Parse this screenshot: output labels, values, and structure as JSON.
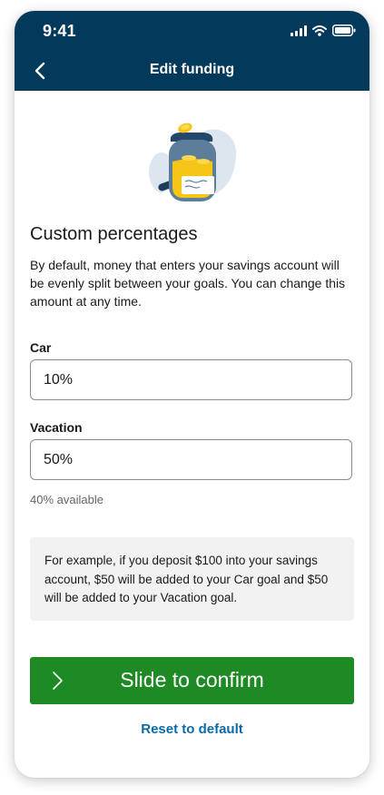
{
  "status_bar": {
    "time": "9:41",
    "icons": [
      "cellular-signal-icon",
      "wifi-icon",
      "battery-icon"
    ]
  },
  "header": {
    "title": "Edit funding",
    "back_icon": "chevron-left-icon",
    "background_color": "#033a5c"
  },
  "illustration": {
    "name": "savings-jar-illustration"
  },
  "main": {
    "heading": "Custom percentages",
    "description": "By default, money that enters your savings account will be evenly split between your goals. You can change this amount at any time."
  },
  "fields": [
    {
      "label": "Car",
      "value": "10%"
    },
    {
      "label": "Vacation",
      "value": "50%"
    }
  ],
  "available_text": "40% available",
  "example_text": "For example, if you deposit $100 into your savings account, $50 will be added to your Car goal and $50 will be added to your Vacation goal.",
  "slide_confirm": {
    "label": "Slide to confirm",
    "icon": "chevron-right-icon",
    "color": "#1e8a23"
  },
  "reset": {
    "label": "Reset to default",
    "color": "#0a6aa8"
  }
}
